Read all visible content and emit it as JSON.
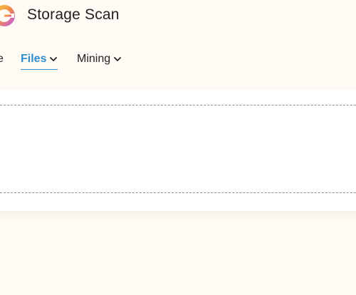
{
  "header": {
    "title": "Storage Scan",
    "logo_icon": "storage-scan-logo-icon"
  },
  "nav": {
    "items": [
      {
        "label": "e",
        "has_dropdown": false,
        "active": false
      },
      {
        "label": "Files",
        "has_dropdown": true,
        "active": true
      },
      {
        "label": "Mining",
        "has_dropdown": true,
        "active": false
      }
    ]
  },
  "colors": {
    "background": "#fffaf4",
    "accent": "#2f8ed0",
    "text": "#222222",
    "panel": "#ffffff",
    "dash": "#8a8f99"
  },
  "icons": {
    "dropdown": "chevron-down-icon"
  }
}
